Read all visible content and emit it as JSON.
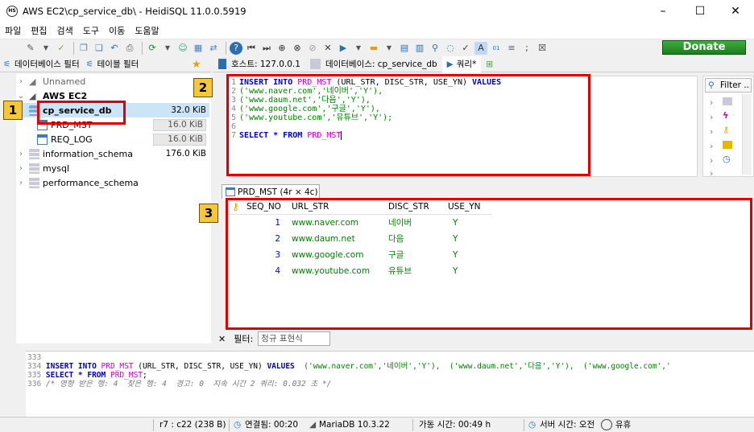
{
  "window": {
    "title": "AWS EC2\\cp_service_db\\ - HeidiSQL 11.0.0.5919",
    "minimize": "–",
    "maximize": "☐",
    "close": "✕"
  },
  "menu": [
    "파일",
    "편집",
    "검색",
    "도구",
    "이동",
    "도움말"
  ],
  "toolbar": {
    "donate_label": "Donate"
  },
  "filter_tabs": {
    "db_filter": "데이터베이스 필터",
    "table_filter": "테이블 필터"
  },
  "tree": {
    "unnamed": "Unnamed",
    "aws": "AWS EC2",
    "db": {
      "name": "cp_service_db",
      "size": "32.0 KiB"
    },
    "tables": [
      {
        "name": "PRD_MST",
        "size": "16.0 KiB"
      },
      {
        "name": "REQ_LOG",
        "size": "16.0 KiB"
      }
    ],
    "schemas": [
      {
        "name": "information_schema",
        "size": "176.0 KiB"
      },
      {
        "name": "mysql",
        "size": ""
      },
      {
        "name": "performance_schema",
        "size": ""
      }
    ]
  },
  "annotations": {
    "a1": "1",
    "a2": "2",
    "a3": "3"
  },
  "conn_tabs": {
    "host": "호스트: 127.0.0.1",
    "database": "데이터베이스: cp_service_db",
    "query": "쿼리*"
  },
  "editor": {
    "lines": [
      {
        "n": "1",
        "kw1": "INSERT INTO ",
        "tbl": "PRD_MST",
        "rest": " (URL_STR, DISC_STR, USE_YN) ",
        "kw2": "VALUES"
      },
      {
        "n": "2",
        "s": "('www.naver.com','네이버','Y'),"
      },
      {
        "n": "3",
        "s": "('www.daum.net','다음','Y'),"
      },
      {
        "n": "4",
        "s": "('www.google.com','구글','Y'),"
      },
      {
        "n": "5",
        "s": "('www.youtube.com','유튜브','Y');"
      },
      {
        "n": "6",
        "s": ""
      },
      {
        "n": "7",
        "kw1": "SELECT * FROM ",
        "tbl": "PRD_MST"
      }
    ]
  },
  "helpers": {
    "filter_label": "Filter .."
  },
  "result": {
    "tab": "PRD_MST (4r × 4c)",
    "columns": [
      "SEQ_NO",
      "URL_STR",
      "DISC_STR",
      "USE_YN"
    ],
    "rows": [
      [
        "1",
        "www.naver.com",
        "네이버",
        "Y"
      ],
      [
        "2",
        "www.daum.net",
        "다음",
        "Y"
      ],
      [
        "3",
        "www.google.com",
        "구글",
        "Y"
      ],
      [
        "4",
        "www.youtube.com",
        "유튜브",
        "Y"
      ]
    ]
  },
  "filterbar": {
    "close": "✕",
    "label": "필터:",
    "placeholder": "정규 표현식"
  },
  "log": {
    "l333": "333",
    "l334_n": "334 ",
    "l334_kw1": "INSERT INTO ",
    "l334_tbl": "PRD_MST",
    "l334_mid": " (URL_STR, DISC_STR, USE_YN) ",
    "l334_kw2": "VALUES",
    "l334_vals": "  ('www.naver.com','네이버','Y'),  ('www.daum.net','다음','Y'),  ('www.google.com','",
    "l335_n": "335 ",
    "l335_kw": "SELECT * FROM ",
    "l335_tbl": "PRD_MST",
    "l335_end": ";",
    "l336_n": "336 ",
    "l336_cm": "/* 영향 받은 행: 4  찾은 행: 4  경고: 0  지속 시간 2 쿼리: 0.032 초 */"
  },
  "status": {
    "pos": "r7 : c22 (238 B)",
    "connected": "연결됨: 00:20",
    "server": "MariaDB 10.3.22",
    "uptime": "가동 시간: 00:49 h",
    "server_time": "서버 시간: 오전",
    "idle": "유휴"
  }
}
